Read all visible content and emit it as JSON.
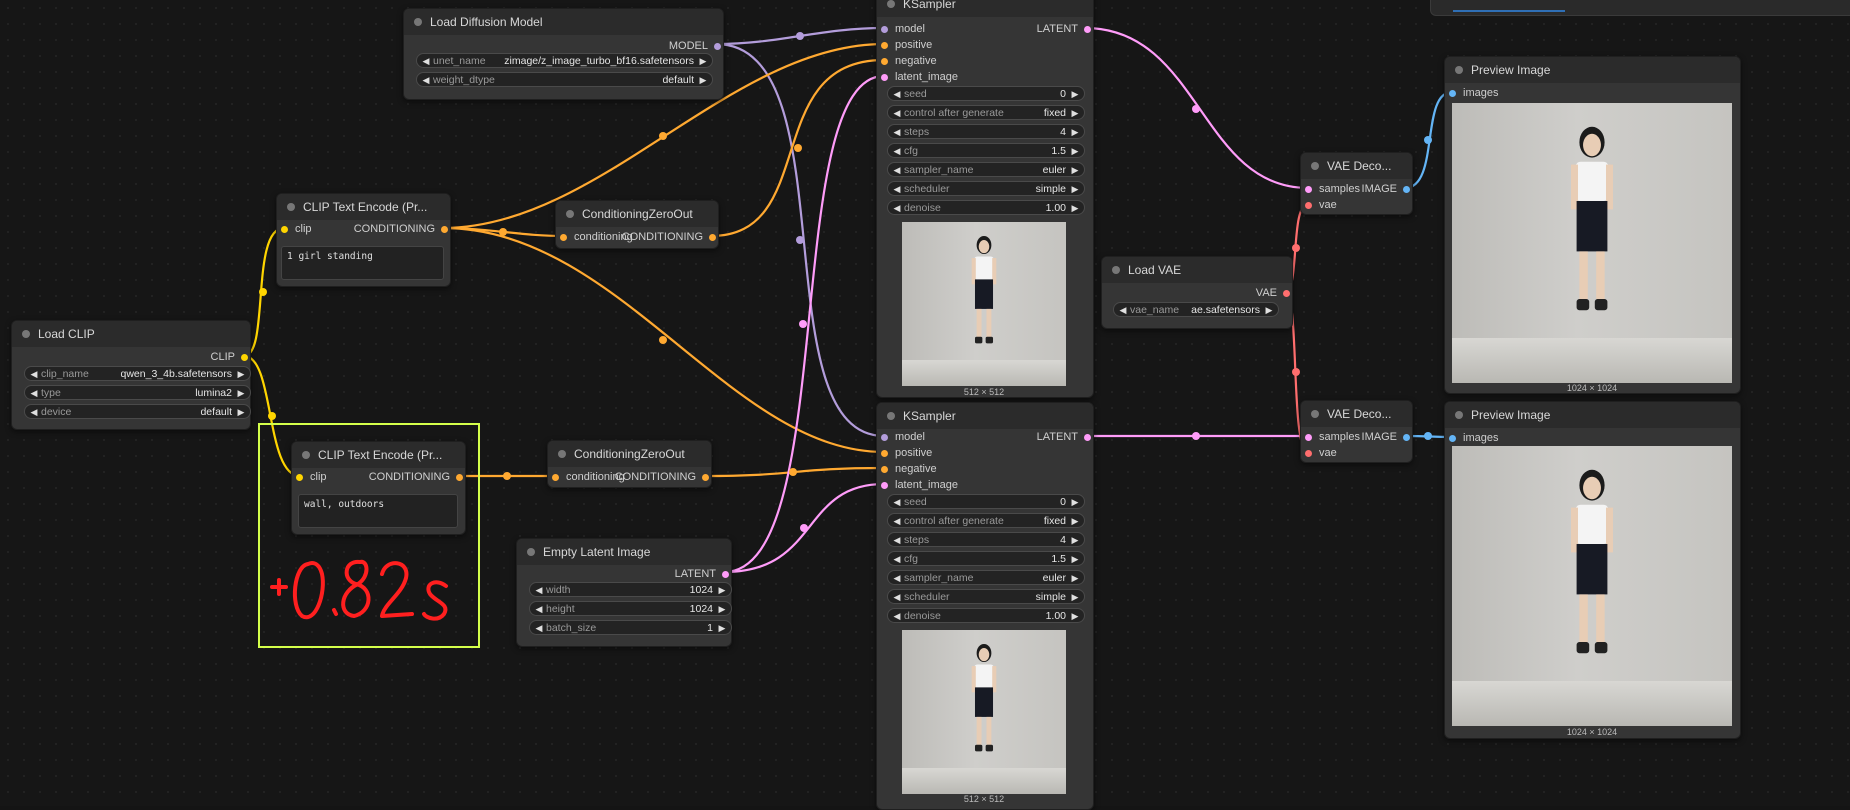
{
  "colors": {
    "model": "#b39ddb",
    "clip": "#ffd500",
    "conditioning": "#ffa931",
    "latent": "#ff9cf9",
    "vae": "#ff6e6e",
    "image": "#64b5f6",
    "group_outline": "#d4ff4a",
    "annotation": "#ff1f1f"
  },
  "nodes": {
    "load_diffusion_model": {
      "title": "Load Diffusion Model",
      "output": "MODEL",
      "widgets": [
        {
          "label": "unet_name",
          "value": "zimage/z_image_turbo_bf16.safetensors"
        },
        {
          "label": "weight_dtype",
          "value": "default"
        }
      ]
    },
    "clip_text_encode_pos": {
      "title": "CLIP Text Encode (Pr...",
      "input": "clip",
      "output": "CONDITIONING",
      "text": "1 girl standing"
    },
    "clip_text_encode_neg": {
      "title": "CLIP Text Encode (Pr...",
      "input": "clip",
      "output": "CONDITIONING",
      "text": "wall, outdoors"
    },
    "load_clip": {
      "title": "Load CLIP",
      "output": "CLIP",
      "widgets": [
        {
          "label": "clip_name",
          "value": "qwen_3_4b.safetensors"
        },
        {
          "label": "type",
          "value": "lumina2"
        },
        {
          "label": "device",
          "value": "default"
        }
      ]
    },
    "cond_zero_out_1": {
      "title": "ConditioningZeroOut",
      "input": "conditioning",
      "output": "CONDITIONING"
    },
    "cond_zero_out_2": {
      "title": "ConditioningZeroOut",
      "input": "conditioning",
      "output": "CONDITIONING"
    },
    "empty_latent": {
      "title": "Empty Latent Image",
      "output": "LATENT",
      "widgets": [
        {
          "label": "width",
          "value": "1024"
        },
        {
          "label": "height",
          "value": "1024"
        },
        {
          "label": "batch_size",
          "value": "1"
        }
      ]
    },
    "ksampler_1": {
      "title": "KSampler",
      "inputs": [
        "model",
        "positive",
        "negative",
        "latent_image"
      ],
      "output": "LATENT",
      "widgets": [
        {
          "label": "seed",
          "value": "0"
        },
        {
          "label": "control after generate",
          "value": "fixed"
        },
        {
          "label": "steps",
          "value": "4"
        },
        {
          "label": "cfg",
          "value": "1.5"
        },
        {
          "label": "sampler_name",
          "value": "euler"
        },
        {
          "label": "scheduler",
          "value": "simple"
        },
        {
          "label": "denoise",
          "value": "1.00"
        }
      ],
      "image_size": "512 × 512"
    },
    "ksampler_2": {
      "title": "KSampler",
      "inputs": [
        "model",
        "positive",
        "negative",
        "latent_image"
      ],
      "output": "LATENT",
      "widgets": [
        {
          "label": "seed",
          "value": "0"
        },
        {
          "label": "control after generate",
          "value": "fixed"
        },
        {
          "label": "steps",
          "value": "4"
        },
        {
          "label": "cfg",
          "value": "1.5"
        },
        {
          "label": "sampler_name",
          "value": "euler"
        },
        {
          "label": "scheduler",
          "value": "simple"
        },
        {
          "label": "denoise",
          "value": "1.00"
        }
      ],
      "image_size": "512 × 512"
    },
    "load_vae": {
      "title": "Load VAE",
      "output": "VAE",
      "widgets": [
        {
          "label": "vae_name",
          "value": "ae.safetensors"
        }
      ]
    },
    "vae_decode_1": {
      "title": "VAE Deco...",
      "inputs": [
        "samples",
        "vae"
      ],
      "output": "IMAGE"
    },
    "vae_decode_2": {
      "title": "VAE Deco...",
      "inputs": [
        "samples",
        "vae"
      ],
      "output": "IMAGE"
    },
    "preview_1": {
      "title": "Preview Image",
      "input": "images",
      "image_size": "1024 × 1024"
    },
    "preview_2": {
      "title": "Preview Image",
      "input": "images",
      "image_size": "1024 × 1024"
    }
  },
  "annotation": {
    "handwritten": "+0.82s"
  },
  "icons": {
    "arrow_left": "◀",
    "arrow_right": "▶"
  }
}
